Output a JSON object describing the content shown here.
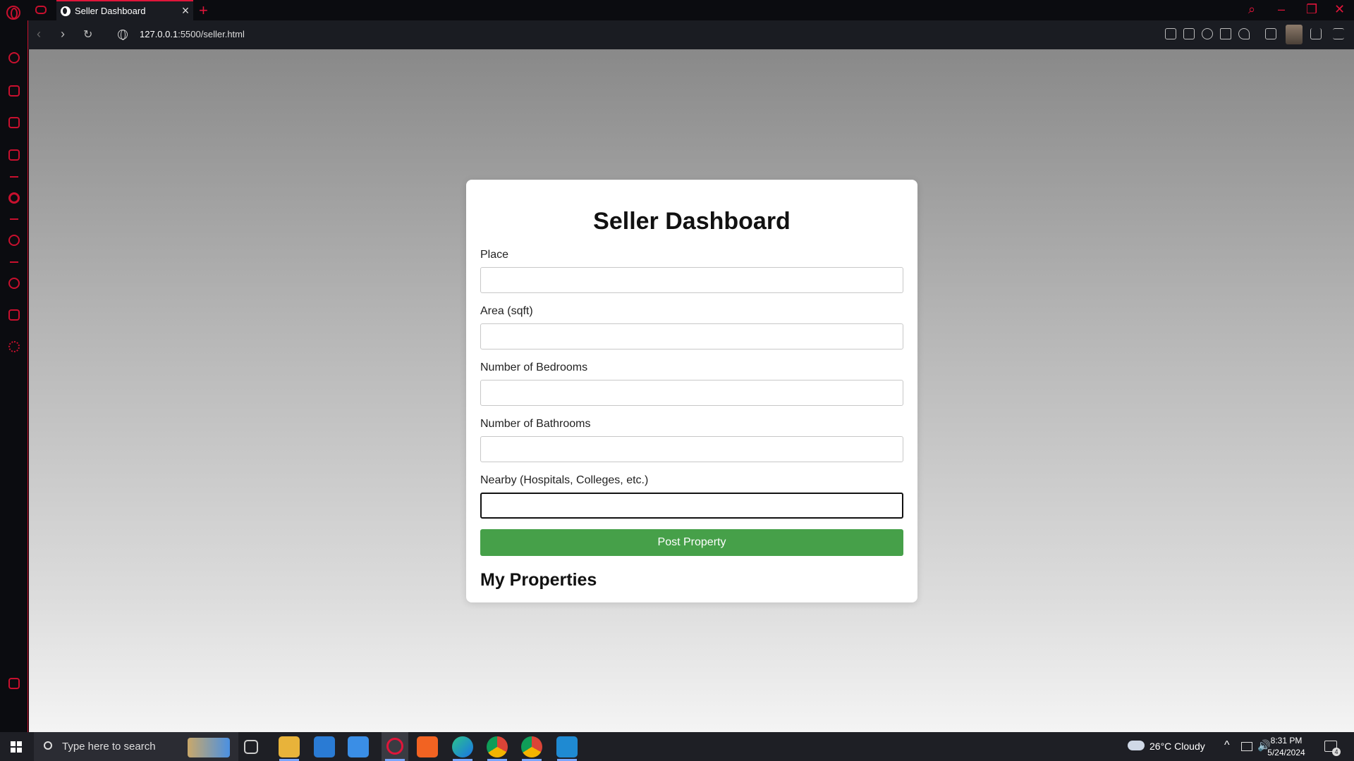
{
  "browser": {
    "tab_title": "Seller Dashboard",
    "tab_close": "×",
    "new_tab": "+",
    "url_host": "127.0.0.1",
    "url_rest": ":5500/seller.html",
    "accent_color": "#e0153a"
  },
  "page": {
    "title": "Seller Dashboard",
    "fields": [
      {
        "label": "Place",
        "value": ""
      },
      {
        "label": "Area (sqft)",
        "value": ""
      },
      {
        "label": "Number of Bedrooms",
        "value": ""
      },
      {
        "label": "Number of Bathrooms",
        "value": ""
      },
      {
        "label": "Nearby (Hospitals, Colleges, etc.)",
        "value": ""
      }
    ],
    "submit_label": "Post Property",
    "submit_color": "#46a049",
    "section_heading": "My Properties"
  },
  "taskbar": {
    "search_placeholder": "Type here to search",
    "weather": "26°C  Cloudy",
    "time": "8:31 PM",
    "date": "5/24/2024",
    "notification_count": "4"
  }
}
